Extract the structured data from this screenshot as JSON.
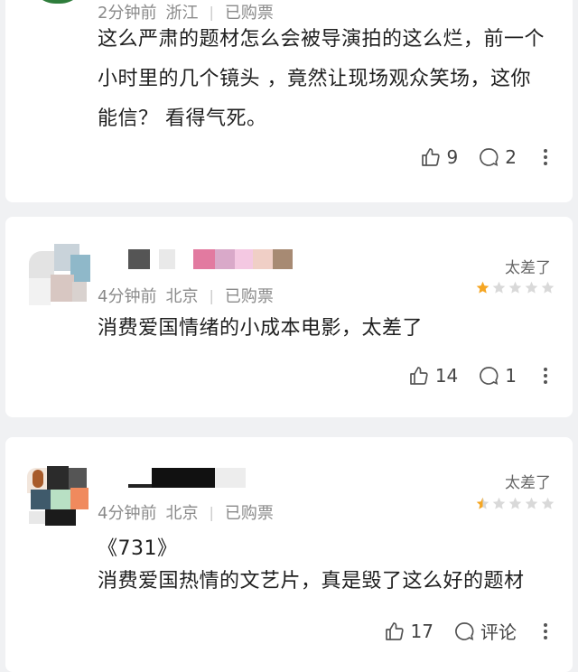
{
  "comments": [
    {
      "time": "2分钟前",
      "location": "浙江",
      "badge": "已购票",
      "text": "这么严肃的题材怎么会被导演拍的这么烂，前一个小时里的几个镜头 ，竟然让现场观众笑场，这你能信？ 看得气死。",
      "likes": "9",
      "replies": "2",
      "more_icon": "more-vertical-icon"
    },
    {
      "rating_label": "太差了",
      "rating_stars": 1,
      "time": "4分钟前",
      "location": "北京",
      "badge": "已购票",
      "text": "消费爱国情绪的小成本电影，太差了",
      "likes": "14",
      "replies": "1",
      "more_icon": "more-vertical-icon"
    },
    {
      "rating_label": "太差了",
      "rating_stars": 0.5,
      "time": "4分钟前",
      "location": "北京",
      "badge": "已购票",
      "title_line": "《731》",
      "text": "消费爱国热情的文艺片，真是毁了这么好的题材",
      "likes": "17",
      "replies": "评论",
      "more_icon": "more-vertical-icon"
    }
  ],
  "colors": {
    "star_active": "#f5a623",
    "star_inactive": "#d9d9d9",
    "background": "#f0f1f3"
  }
}
